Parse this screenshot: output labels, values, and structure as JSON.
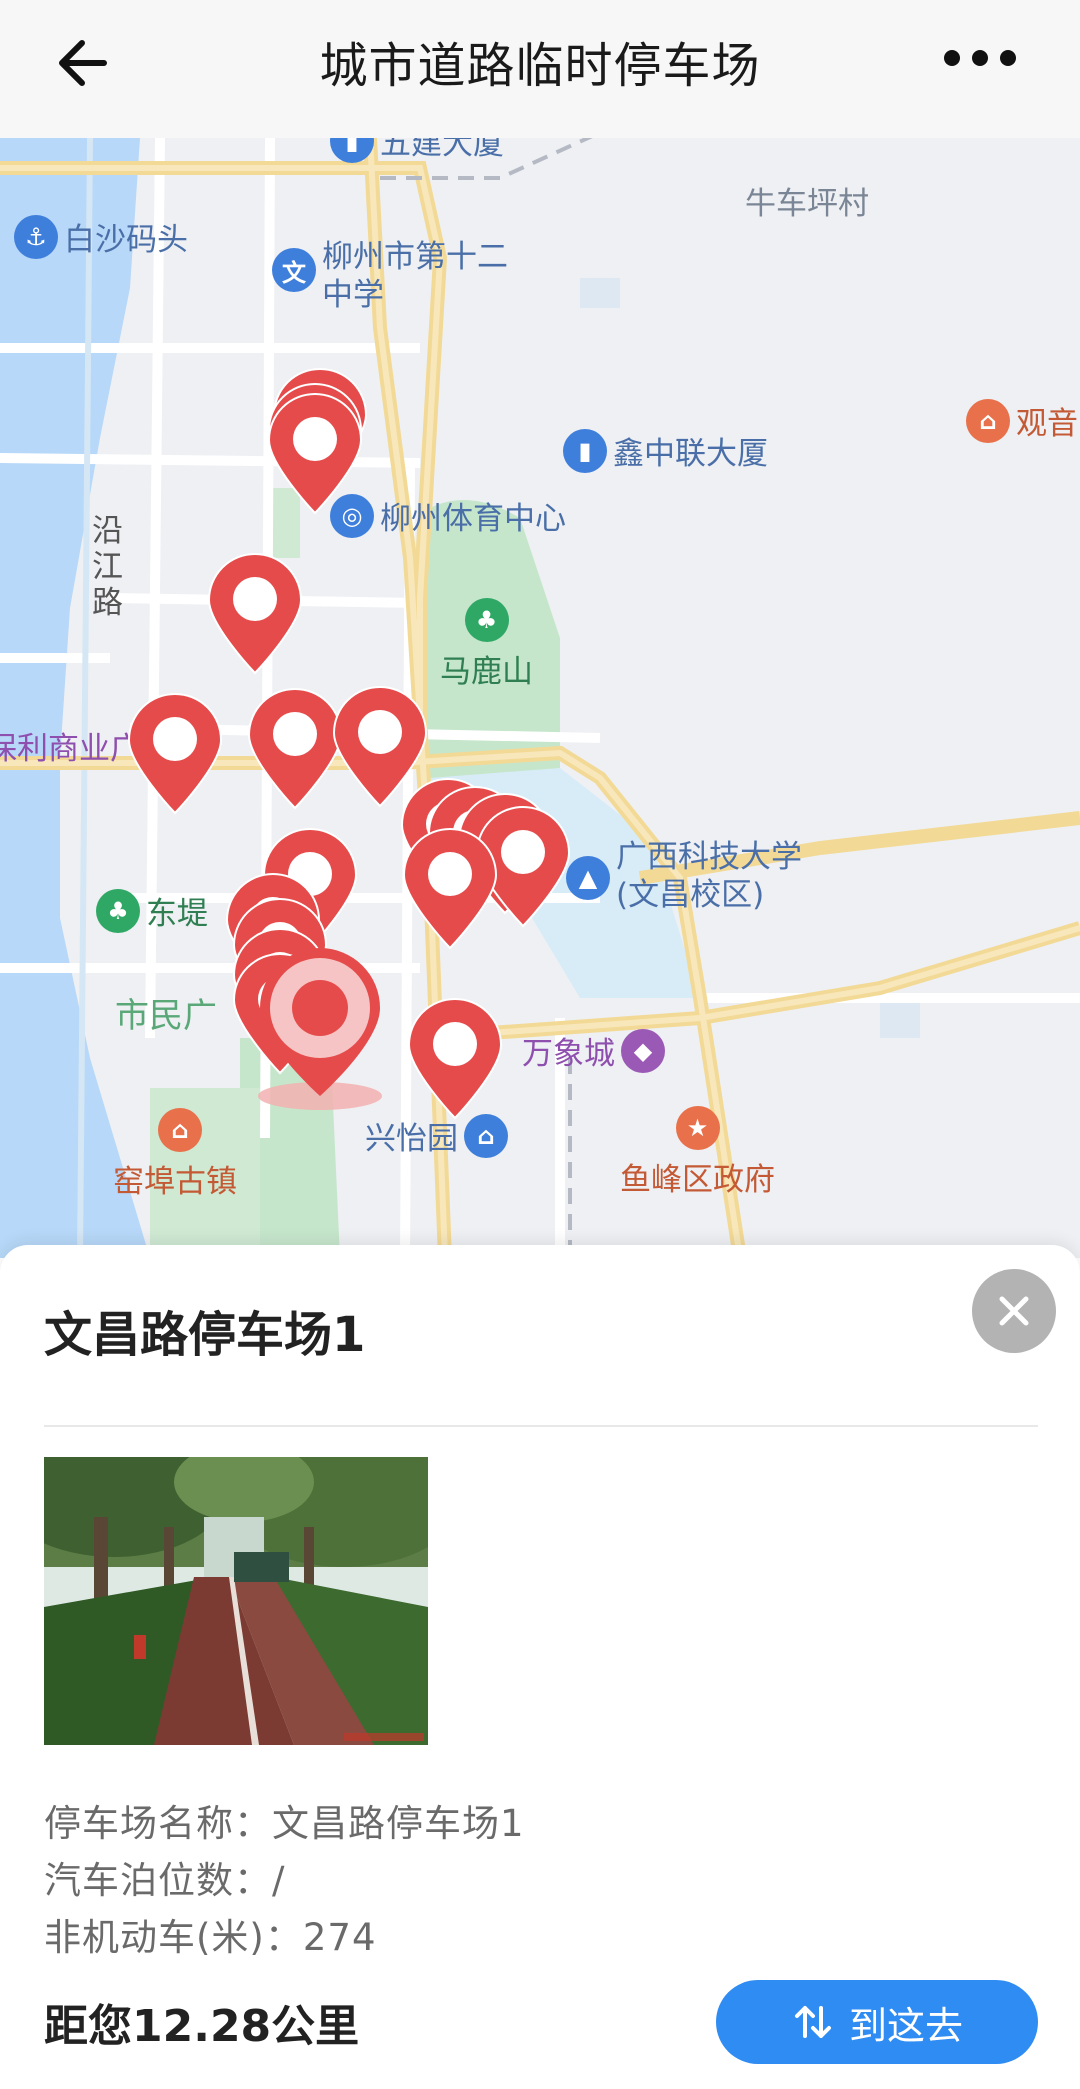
{
  "header": {
    "title": "城市道路临时停车场",
    "back_icon": "arrow-left-icon",
    "more_icon": "more-dots-icon"
  },
  "map": {
    "pois": [
      {
        "label": "五建大厦",
        "icon": "building-icon",
        "color": "#3f7fdc"
      },
      {
        "label": "牛车坪村",
        "icon": "",
        "color": "#7a8696"
      },
      {
        "label": "白沙码头",
        "icon": "anchor-icon",
        "color": "#3f7fdc"
      },
      {
        "label": "柳州市第十二",
        "label2": "中学",
        "icon": "school-icon",
        "color": "#3f7fdc"
      },
      {
        "label": "观音",
        "icon": "temple-icon",
        "color": "#e8704a"
      },
      {
        "label": "鑫中联大厦",
        "icon": "building-icon",
        "color": "#3f7fdc"
      },
      {
        "label": "柳州体育中心",
        "icon": "stadium-icon",
        "color": "#3f7fdc"
      },
      {
        "label": "马鹿山",
        "icon": "park-icon",
        "color": "#2fa866"
      },
      {
        "label": "保利商业广",
        "icon": "",
        "color": "#9b59b6"
      },
      {
        "label": "广西科技大学",
        "label2": "(文昌校区)",
        "icon": "graduation-cap-icon",
        "color": "#3f7fdc"
      },
      {
        "label": "东堤",
        "icon": "park-icon",
        "color": "#2fa866"
      },
      {
        "label": "市民广",
        "icon": "",
        "color": "#2fa866"
      },
      {
        "label": "万象城",
        "icon": "shopping-bag-icon",
        "color": "#9b59b6"
      },
      {
        "label": "兴怡园",
        "icon": "residence-icon",
        "color": "#3f7fdc"
      },
      {
        "label": "窑埠古镇",
        "icon": "temple-icon",
        "color": "#e8704a"
      },
      {
        "label": "鱼峰区政府",
        "icon": "government-icon",
        "color": "#e8704a"
      }
    ],
    "road_label": "沿江路",
    "marker_color": "#e64b4b"
  },
  "sheet": {
    "title": "文昌路停车场1",
    "close_icon": "close-icon",
    "info": {
      "name_label": "停车场名称：",
      "name_value": "文昌路停车场1",
      "car_label": "汽车泊位数：",
      "car_value": "/",
      "bike_label": "非机动车(米)：",
      "bike_value": "274"
    },
    "distance": "距您12.28公里",
    "go_button": "到这去",
    "go_icon": "swap-arrows-icon"
  }
}
